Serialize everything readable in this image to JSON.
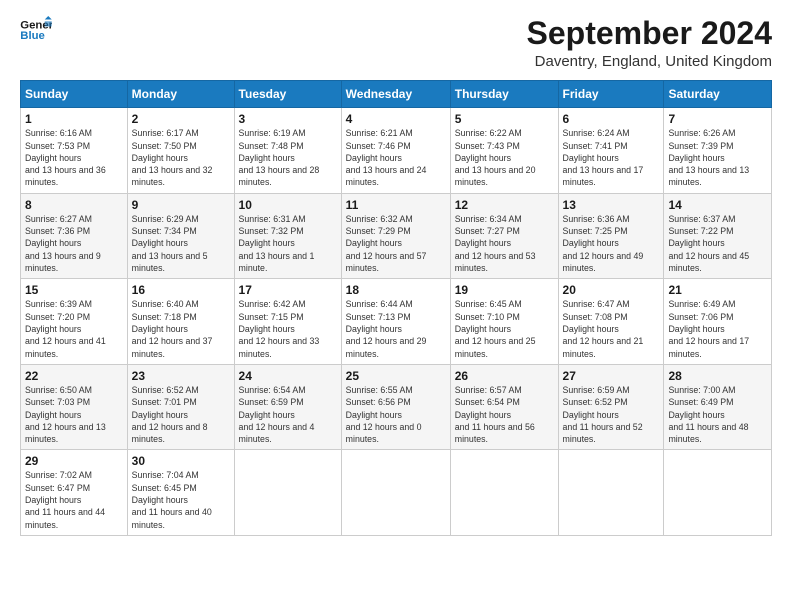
{
  "logo": {
    "line1": "General",
    "line2": "Blue"
  },
  "title": "September 2024",
  "subtitle": "Daventry, England, United Kingdom",
  "header_days": [
    "Sunday",
    "Monday",
    "Tuesday",
    "Wednesday",
    "Thursday",
    "Friday",
    "Saturday"
  ],
  "weeks": [
    [
      {
        "day": 1,
        "sunrise": "6:16 AM",
        "sunset": "7:53 PM",
        "daylight": "13 hours and 36 minutes."
      },
      {
        "day": 2,
        "sunrise": "6:17 AM",
        "sunset": "7:50 PM",
        "daylight": "13 hours and 32 minutes."
      },
      {
        "day": 3,
        "sunrise": "6:19 AM",
        "sunset": "7:48 PM",
        "daylight": "13 hours and 28 minutes."
      },
      {
        "day": 4,
        "sunrise": "6:21 AM",
        "sunset": "7:46 PM",
        "daylight": "13 hours and 24 minutes."
      },
      {
        "day": 5,
        "sunrise": "6:22 AM",
        "sunset": "7:43 PM",
        "daylight": "13 hours and 20 minutes."
      },
      {
        "day": 6,
        "sunrise": "6:24 AM",
        "sunset": "7:41 PM",
        "daylight": "13 hours and 17 minutes."
      },
      {
        "day": 7,
        "sunrise": "6:26 AM",
        "sunset": "7:39 PM",
        "daylight": "13 hours and 13 minutes."
      }
    ],
    [
      {
        "day": 8,
        "sunrise": "6:27 AM",
        "sunset": "7:36 PM",
        "daylight": "13 hours and 9 minutes."
      },
      {
        "day": 9,
        "sunrise": "6:29 AM",
        "sunset": "7:34 PM",
        "daylight": "13 hours and 5 minutes."
      },
      {
        "day": 10,
        "sunrise": "6:31 AM",
        "sunset": "7:32 PM",
        "daylight": "13 hours and 1 minute."
      },
      {
        "day": 11,
        "sunrise": "6:32 AM",
        "sunset": "7:29 PM",
        "daylight": "12 hours and 57 minutes."
      },
      {
        "day": 12,
        "sunrise": "6:34 AM",
        "sunset": "7:27 PM",
        "daylight": "12 hours and 53 minutes."
      },
      {
        "day": 13,
        "sunrise": "6:36 AM",
        "sunset": "7:25 PM",
        "daylight": "12 hours and 49 minutes."
      },
      {
        "day": 14,
        "sunrise": "6:37 AM",
        "sunset": "7:22 PM",
        "daylight": "12 hours and 45 minutes."
      }
    ],
    [
      {
        "day": 15,
        "sunrise": "6:39 AM",
        "sunset": "7:20 PM",
        "daylight": "12 hours and 41 minutes."
      },
      {
        "day": 16,
        "sunrise": "6:40 AM",
        "sunset": "7:18 PM",
        "daylight": "12 hours and 37 minutes."
      },
      {
        "day": 17,
        "sunrise": "6:42 AM",
        "sunset": "7:15 PM",
        "daylight": "12 hours and 33 minutes."
      },
      {
        "day": 18,
        "sunrise": "6:44 AM",
        "sunset": "7:13 PM",
        "daylight": "12 hours and 29 minutes."
      },
      {
        "day": 19,
        "sunrise": "6:45 AM",
        "sunset": "7:10 PM",
        "daylight": "12 hours and 25 minutes."
      },
      {
        "day": 20,
        "sunrise": "6:47 AM",
        "sunset": "7:08 PM",
        "daylight": "12 hours and 21 minutes."
      },
      {
        "day": 21,
        "sunrise": "6:49 AM",
        "sunset": "7:06 PM",
        "daylight": "12 hours and 17 minutes."
      }
    ],
    [
      {
        "day": 22,
        "sunrise": "6:50 AM",
        "sunset": "7:03 PM",
        "daylight": "12 hours and 13 minutes."
      },
      {
        "day": 23,
        "sunrise": "6:52 AM",
        "sunset": "7:01 PM",
        "daylight": "12 hours and 8 minutes."
      },
      {
        "day": 24,
        "sunrise": "6:54 AM",
        "sunset": "6:59 PM",
        "daylight": "12 hours and 4 minutes."
      },
      {
        "day": 25,
        "sunrise": "6:55 AM",
        "sunset": "6:56 PM",
        "daylight": "12 hours and 0 minutes."
      },
      {
        "day": 26,
        "sunrise": "6:57 AM",
        "sunset": "6:54 PM",
        "daylight": "11 hours and 56 minutes."
      },
      {
        "day": 27,
        "sunrise": "6:59 AM",
        "sunset": "6:52 PM",
        "daylight": "11 hours and 52 minutes."
      },
      {
        "day": 28,
        "sunrise": "7:00 AM",
        "sunset": "6:49 PM",
        "daylight": "11 hours and 48 minutes."
      }
    ],
    [
      {
        "day": 29,
        "sunrise": "7:02 AM",
        "sunset": "6:47 PM",
        "daylight": "11 hours and 44 minutes."
      },
      {
        "day": 30,
        "sunrise": "7:04 AM",
        "sunset": "6:45 PM",
        "daylight": "11 hours and 40 minutes."
      },
      null,
      null,
      null,
      null,
      null
    ]
  ]
}
